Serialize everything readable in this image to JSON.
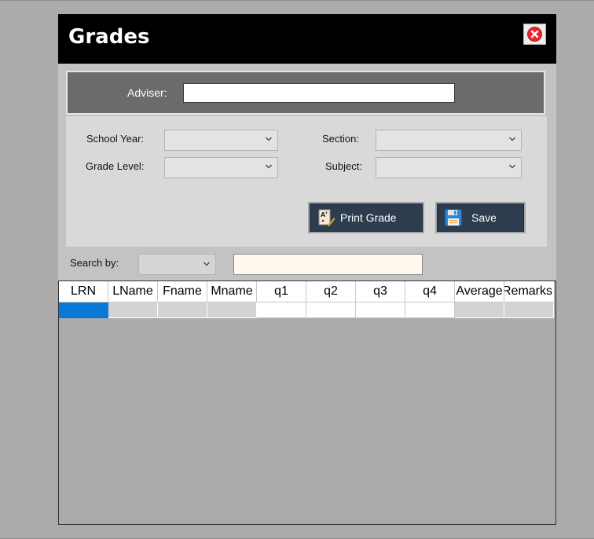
{
  "dialog": {
    "title": "Grades",
    "close_icon": "close-icon",
    "accent_red": "#e8262e",
    "titlebar_color": "#000000"
  },
  "adviser": {
    "label": "Adviser:",
    "value": ""
  },
  "filters": {
    "school_year": {
      "label": "School Year:",
      "value": ""
    },
    "grade_level": {
      "label": "Grade Level:",
      "value": ""
    },
    "section": {
      "label": "Section:",
      "value": ""
    },
    "subject": {
      "label": "Subject:",
      "value": ""
    }
  },
  "actions": {
    "print": {
      "label": "Print Grade",
      "icon": "grade-sheet-icon"
    },
    "save": {
      "label": "Save",
      "icon": "floppy-disk-icon"
    },
    "button_color": "#2e3c4f"
  },
  "search": {
    "label": "Search by:",
    "field_value": "",
    "query": ""
  },
  "grid": {
    "columns": [
      "LRN",
      "LName",
      "Fname",
      "Mname",
      "q1",
      "q2",
      "q3",
      "q4",
      "Average",
      "Remarks"
    ],
    "rows": [
      [
        "",
        "",
        "",
        "",
        "",
        "",
        "",
        "",
        "",
        ""
      ]
    ],
    "selection_color": "#0a78d6"
  }
}
